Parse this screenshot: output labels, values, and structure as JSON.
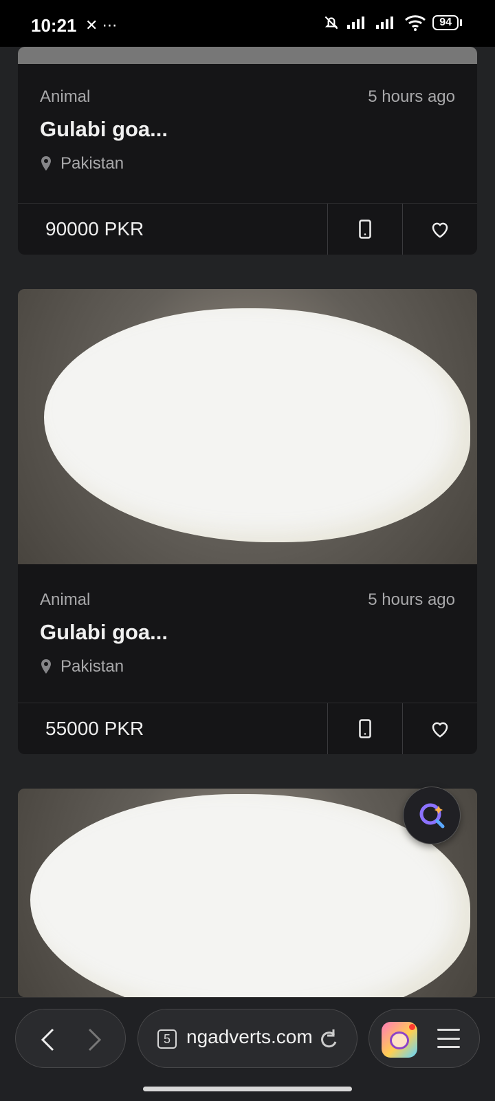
{
  "status_bar": {
    "time": "10:21",
    "extra_icons": "✕ ⋯",
    "battery": "94"
  },
  "listings": [
    {
      "category": "Animal",
      "age": "5 hours ago",
      "title": "Gulabi goa...",
      "location": "Pakistan",
      "price": "90000 PKR"
    },
    {
      "category": "Animal",
      "age": "5 hours ago",
      "title": "Gulabi goa...",
      "location": "Pakistan",
      "price": "55000 PKR"
    },
    {
      "category": "",
      "age": "",
      "title": "",
      "location": "",
      "price": ""
    }
  ],
  "browser": {
    "tab_count": "5",
    "url": "ngadverts.com"
  },
  "colors": {
    "accent": "#5aa8ff",
    "background": "#222325",
    "card": "#151517"
  }
}
